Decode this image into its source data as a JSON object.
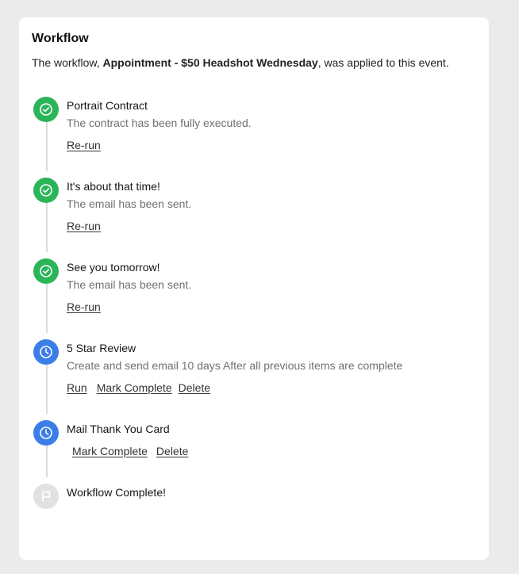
{
  "workflow": {
    "title": "Workflow",
    "description_prefix": "The workflow,",
    "workflow_name": "Appointment - $50 Headshot Wednesday",
    "description_suffix": ", was applied to this event."
  },
  "steps": [
    {
      "title": "Portrait Contract",
      "subtitle": "The contract has been fully executed.",
      "status": "complete",
      "icon": "check-circle-icon",
      "actions": [
        "Re-run"
      ]
    },
    {
      "title": "It's about that time!",
      "subtitle": "The email has been sent.",
      "status": "complete",
      "icon": "check-circle-icon",
      "actions": [
        "Re-run"
      ]
    },
    {
      "title": "See you tomorrow!",
      "subtitle": "The email has been sent.",
      "status": "complete",
      "icon": "check-circle-icon",
      "actions": [
        "Re-run"
      ]
    },
    {
      "title": "5 Star Review",
      "subtitle": "Create and send email 10 days After all previous items are complete",
      "status": "pending",
      "icon": "clock-icon",
      "actions": [
        "Run",
        "Mark Complete",
        "Delete"
      ]
    },
    {
      "title": "Mail Thank You Card",
      "subtitle": "",
      "status": "pending",
      "icon": "clock-icon",
      "actions": [
        "Mark Complete",
        "Delete"
      ]
    },
    {
      "title": "Workflow Complete!",
      "subtitle": "",
      "status": "final",
      "icon": "flag-icon",
      "actions": []
    }
  ],
  "colors": {
    "complete": "#2bb558",
    "pending": "#3b7ee8",
    "final": "#e1e1e1",
    "background": "#ebebeb"
  }
}
